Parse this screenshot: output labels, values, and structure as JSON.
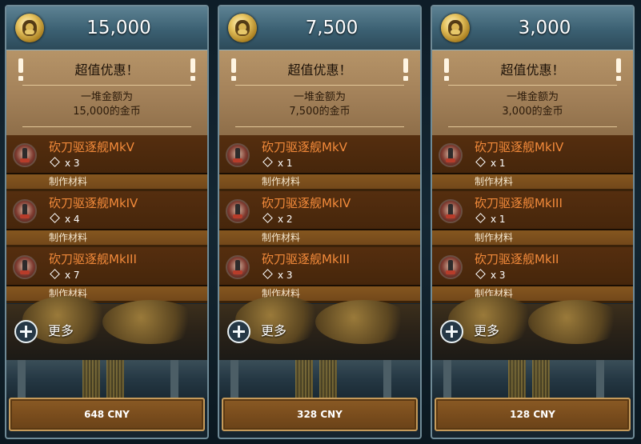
{
  "offers": [
    {
      "amount": "15,000",
      "promo_title": "超值优惠！",
      "promo_line1": "一堆金额为",
      "promo_line2": "15,000的金币",
      "items": [
        {
          "name": "砍刀驱逐舰MkV",
          "qty": "x 3",
          "material_label": "制作材料"
        },
        {
          "name": "砍刀驱逐舰MkIV",
          "qty": "x 4",
          "material_label": "制作材料"
        },
        {
          "name": "砍刀驱逐舰MkIII",
          "qty": "x 7",
          "material_label": "制作材料"
        }
      ],
      "more_label": "更多",
      "price": "648 CNY"
    },
    {
      "amount": "7,500",
      "promo_title": "超值优惠！",
      "promo_line1": "一堆金额为",
      "promo_line2": "7,500的金币",
      "items": [
        {
          "name": "砍刀驱逐舰MkV",
          "qty": "x 1",
          "material_label": "制作材料"
        },
        {
          "name": "砍刀驱逐舰MkIV",
          "qty": "x 2",
          "material_label": "制作材料"
        },
        {
          "name": "砍刀驱逐舰MkIII",
          "qty": "x 3",
          "material_label": "制作材料"
        }
      ],
      "more_label": "更多",
      "price": "328 CNY"
    },
    {
      "amount": "3,000",
      "promo_title": "超值优惠！",
      "promo_line1": "一堆金额为",
      "promo_line2": "3,000的金币",
      "items": [
        {
          "name": "砍刀驱逐舰MkIV",
          "qty": "x 1",
          "material_label": "制作材料"
        },
        {
          "name": "砍刀驱逐舰MkIII",
          "qty": "x 1",
          "material_label": "制作材料"
        },
        {
          "name": "砍刀驱逐舰MkII",
          "qty": "x 3",
          "material_label": "制作材料"
        }
      ],
      "more_label": "更多",
      "price": "128 CNY"
    }
  ],
  "icons": {
    "currency": "gold-coin-icon",
    "alert": "exclamation-icon",
    "item": "destroyer-ship-icon",
    "quantity": "diamond-icon",
    "more": "plus-circle-icon"
  },
  "colors": {
    "item_name": "#f28a3a",
    "promo_bg": "#a4825a",
    "price_border": "#c59a5a",
    "card_border": "#6f8a96"
  }
}
